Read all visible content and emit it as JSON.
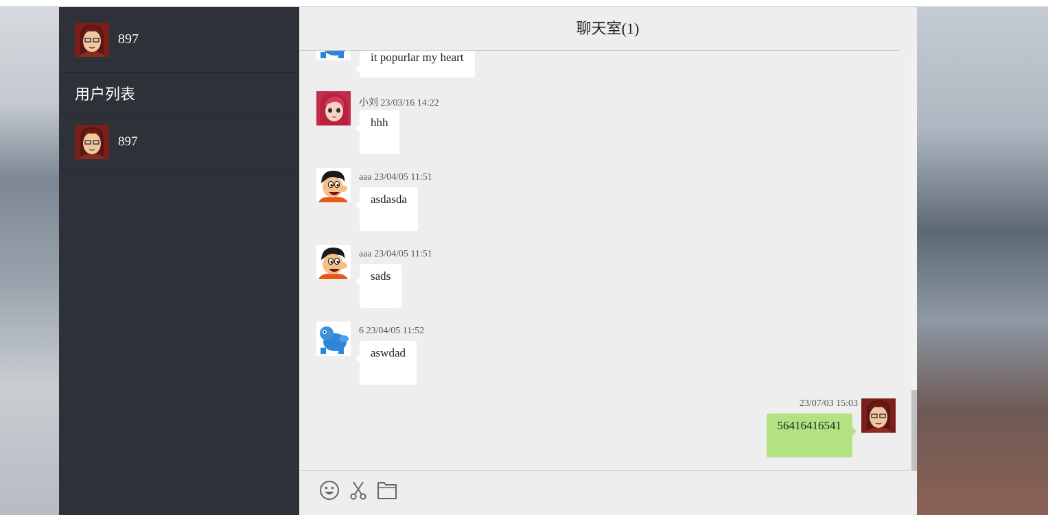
{
  "current_user": {
    "name": "897",
    "avatar": "boy-avatar"
  },
  "sidebar": {
    "title": "用户列表",
    "users": [
      {
        "name": "897",
        "avatar": "boy-avatar"
      }
    ]
  },
  "chat": {
    "title": "聊天室(1)",
    "messages": [
      {
        "text": "it  popurlar  my  heart",
        "avatar": "blue-creature-avatar",
        "partial": true
      },
      {
        "sender": "小刘",
        "time": "23/03/16 14:22",
        "text": "hhh",
        "avatar": "girl-avatar"
      },
      {
        "sender": "aaa",
        "time": "23/04/05 11:51",
        "text": "asdasda",
        "avatar": "cartoon-man-avatar"
      },
      {
        "sender": "aaa",
        "time": "23/04/05 11:51",
        "text": "sads",
        "avatar": "cartoon-man-avatar"
      },
      {
        "sender": "6",
        "time": "23/04/05 11:52",
        "text": "aswdad",
        "avatar": "blue-creature-avatar"
      }
    ],
    "self_message": {
      "time": "23/07/03 15:03",
      "text": "56416416541",
      "avatar": "boy-avatar"
    }
  },
  "toolbar": {
    "icons": [
      "emoji-icon",
      "scissors-icon",
      "folder-icon"
    ]
  },
  "colors": {
    "sidebar": "#2e3138",
    "main": "#eeeeee",
    "self_bubble": "#b2e281",
    "other_bubble": "#ffffff"
  }
}
